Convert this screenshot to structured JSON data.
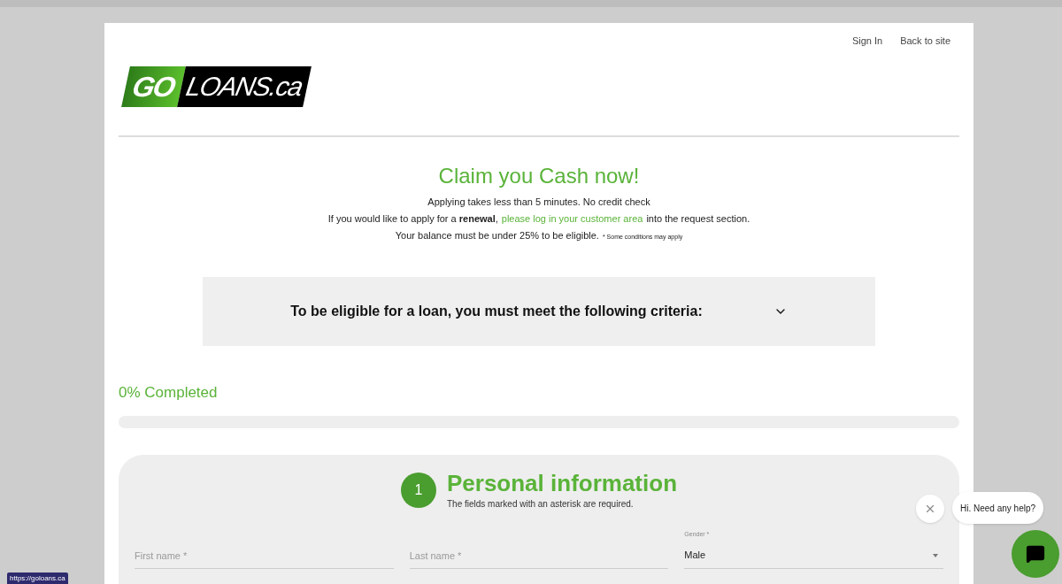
{
  "nav": {
    "links": [
      "Sign In",
      "Back to site"
    ]
  },
  "logo": {
    "part_1": "GO",
    "part_2": "LOANS.ca"
  },
  "hero": {
    "title": "Claim you Cash now!",
    "line_1": "Applying takes less than 5 minutes. No credit check",
    "line_2_before": "If you would like to apply for a **renewal**,",
    "line_2_link": "please log in your customer area",
    "line_2_after": "into the request section.",
    "line_3": "Your balance must be under 25% to be eligible.",
    "line_3_note": "* Some conditions may apply"
  },
  "criteria": {
    "title": "To be eligible for a loan, you must meet the following criteria:",
    "expanded": false
  },
  "progress": {
    "label": "0% Completed",
    "level": 0
  },
  "form": {
    "step": "1",
    "title": "Personal information",
    "subtitle": "The fields marked with an asterisk are required.",
    "fields": [
      {
        "kind": "text",
        "placeholder": "First name *"
      },
      {
        "kind": "text",
        "placeholder": "Last name *"
      },
      {
        "kind": "select",
        "label": "Gender *",
        "value": "Male"
      }
    ]
  },
  "chat": {
    "message": "Hi. Need any help?"
  },
  "status_url": "https://goloans.ca"
}
